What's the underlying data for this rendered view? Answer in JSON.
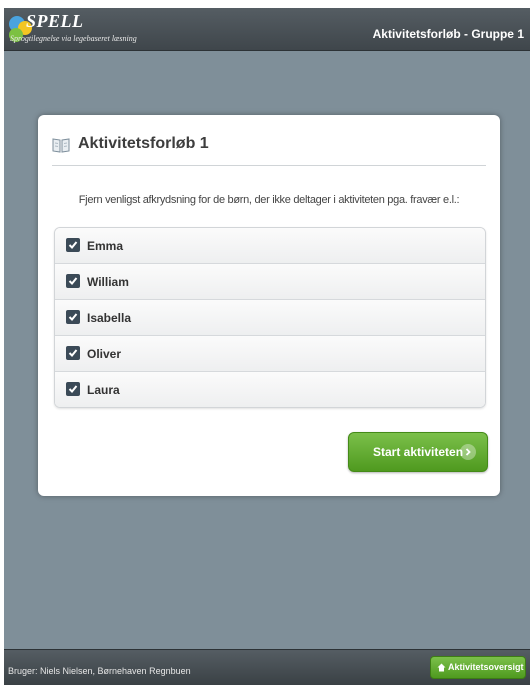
{
  "header": {
    "logo_text": "SPELL",
    "logo_subtitle": "Sprogtilegnelse via legebaseret læsning",
    "title": "Aktivitetsforløb - Gruppe 1"
  },
  "card": {
    "title": "Aktivitetsforløb 1",
    "instruction": "Fjern venligst afkrydsning for de børn, der ikke deltager i aktiviteten pga. fravær e.l.:",
    "children": [
      {
        "name": "Emma",
        "checked": true
      },
      {
        "name": "William",
        "checked": true
      },
      {
        "name": "Isabella",
        "checked": true
      },
      {
        "name": "Oliver",
        "checked": true
      },
      {
        "name": "Laura",
        "checked": true
      }
    ],
    "start_button": "Start aktiviteten"
  },
  "footer": {
    "user": "Bruger: Niels Nielsen, Børnehaven Regnbuen",
    "overview_button": "Aktivitetsoversigt"
  },
  "colors": {
    "background": "#7f8f99",
    "bar": "#4a5257",
    "accent_green": "#5fa92e",
    "checkbox": "#3b4a57"
  }
}
